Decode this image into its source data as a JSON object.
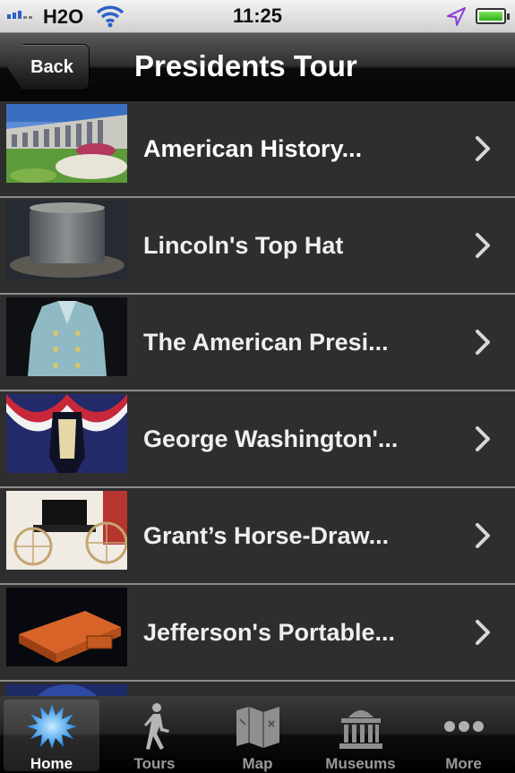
{
  "status_bar": {
    "carrier": "H2O",
    "time": "11:25"
  },
  "nav": {
    "back_label": "Back",
    "title": "Presidents Tour"
  },
  "list": {
    "items": [
      {
        "label": "American History..."
      },
      {
        "label": "Lincoln's Top Hat"
      },
      {
        "label": "The American Presi..."
      },
      {
        "label": "George Washington'..."
      },
      {
        "label": "Grant’s Horse-Draw..."
      },
      {
        "label": "Jefferson's Portable..."
      }
    ]
  },
  "tab_bar": {
    "tabs": [
      {
        "label": "Home",
        "icon": "starburst-icon",
        "active": true
      },
      {
        "label": "Tours",
        "icon": "walking-person-icon",
        "active": false
      },
      {
        "label": "Map",
        "icon": "folded-map-icon",
        "active": false
      },
      {
        "label": "Museums",
        "icon": "museum-building-icon",
        "active": false
      },
      {
        "label": "More",
        "icon": "ellipsis-icon",
        "active": false
      }
    ]
  },
  "colors": {
    "nav_background": "#0a0a0a",
    "list_background": "#2e2e2e",
    "row_separator": "#8c8c8c",
    "active_tab_icon": "#4aa8ff"
  }
}
